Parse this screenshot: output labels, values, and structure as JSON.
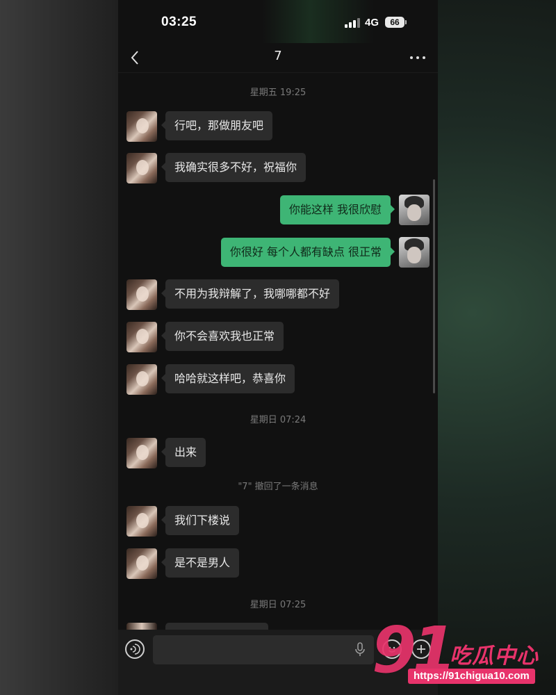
{
  "status_bar": {
    "time": "03:25",
    "network": "4G",
    "battery": "66"
  },
  "header": {
    "title": "7"
  },
  "timestamps": [
    "星期五 19:25",
    "星期日 07:24",
    "星期日 07:25"
  ],
  "messages": [
    {
      "sender": "contact",
      "text": "行吧，那做朋友吧"
    },
    {
      "sender": "contact",
      "text": "我确实很多不好，祝福你"
    },
    {
      "sender": "me",
      "text": "你能这样 我很欣慰"
    },
    {
      "sender": "me",
      "text": "你很好 每个人都有缺点 很正常"
    },
    {
      "sender": "contact",
      "text": "不用为我辩解了，我哪哪都不好"
    },
    {
      "sender": "contact",
      "text": "你不会喜欢我也正常"
    },
    {
      "sender": "contact",
      "text": "哈哈就这样吧，恭喜你"
    },
    {
      "sender": "contact",
      "text": "出来"
    },
    {
      "sender": "contact",
      "text": "我们下楼说"
    },
    {
      "sender": "contact",
      "text": "是不是男人"
    }
  ],
  "system_notice": "\"7\" 撤回了一条消息",
  "input": {
    "value": "",
    "placeholder": ""
  },
  "icons": {
    "back": "chevron-left-icon",
    "more": "more-dots-icon",
    "voice": "voice-icon",
    "mic": "microphone-icon",
    "emoji": "emoji-icon",
    "plus": "plus-icon"
  },
  "colors": {
    "outgoing_bubble": "#3eb575",
    "incoming_bubble": "#2c2c2c",
    "background": "#111111",
    "watermark": "#e8336b"
  },
  "watermark": {
    "number": "91",
    "text": "吃瓜中心",
    "url": "https://91chigua10.com"
  }
}
